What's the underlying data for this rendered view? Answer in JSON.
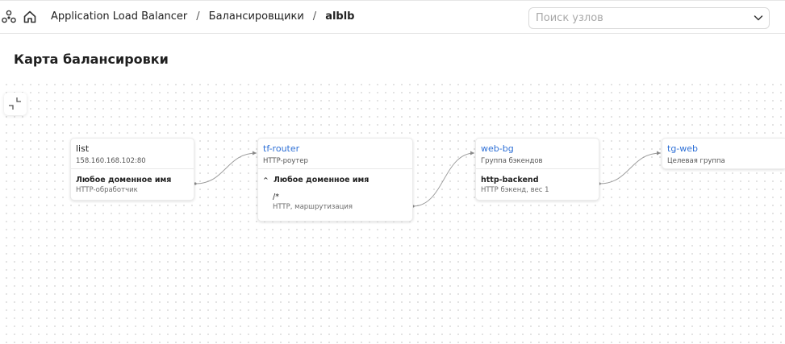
{
  "header": {
    "breadcrumbs": [
      "Application Load Balancer",
      "Балансировщики",
      "alblb"
    ],
    "separator": "/"
  },
  "search": {
    "placeholder": "Поиск узлов",
    "value": ""
  },
  "page": {
    "title": "Карта балансировки"
  },
  "nodes": {
    "listener": {
      "name": "list",
      "sub": "158.160.168.102:80",
      "row": {
        "title": "Любое доменное имя",
        "sub": "HTTP-обработчик"
      }
    },
    "router": {
      "name": "tf-router",
      "sub": "HTTP-роутер",
      "host": "Любое доменное имя",
      "route": {
        "title": "/*",
        "sub": "HTTP, маршрутизация"
      }
    },
    "backend_group": {
      "name": "web-bg",
      "sub": "Группа бэкендов",
      "row": {
        "title": "http-backend",
        "sub": "HTTP бэкенд, вес 1"
      }
    },
    "target_group": {
      "name": "tg-web",
      "sub": "Целевая группа"
    }
  },
  "colors": {
    "link": "#2d6fd6",
    "edge": "#9a9a9a",
    "dot": "#dcdcdc"
  },
  "icons": [
    "nodes-icon",
    "home-icon",
    "chevron-down-icon",
    "collapse-icon"
  ]
}
